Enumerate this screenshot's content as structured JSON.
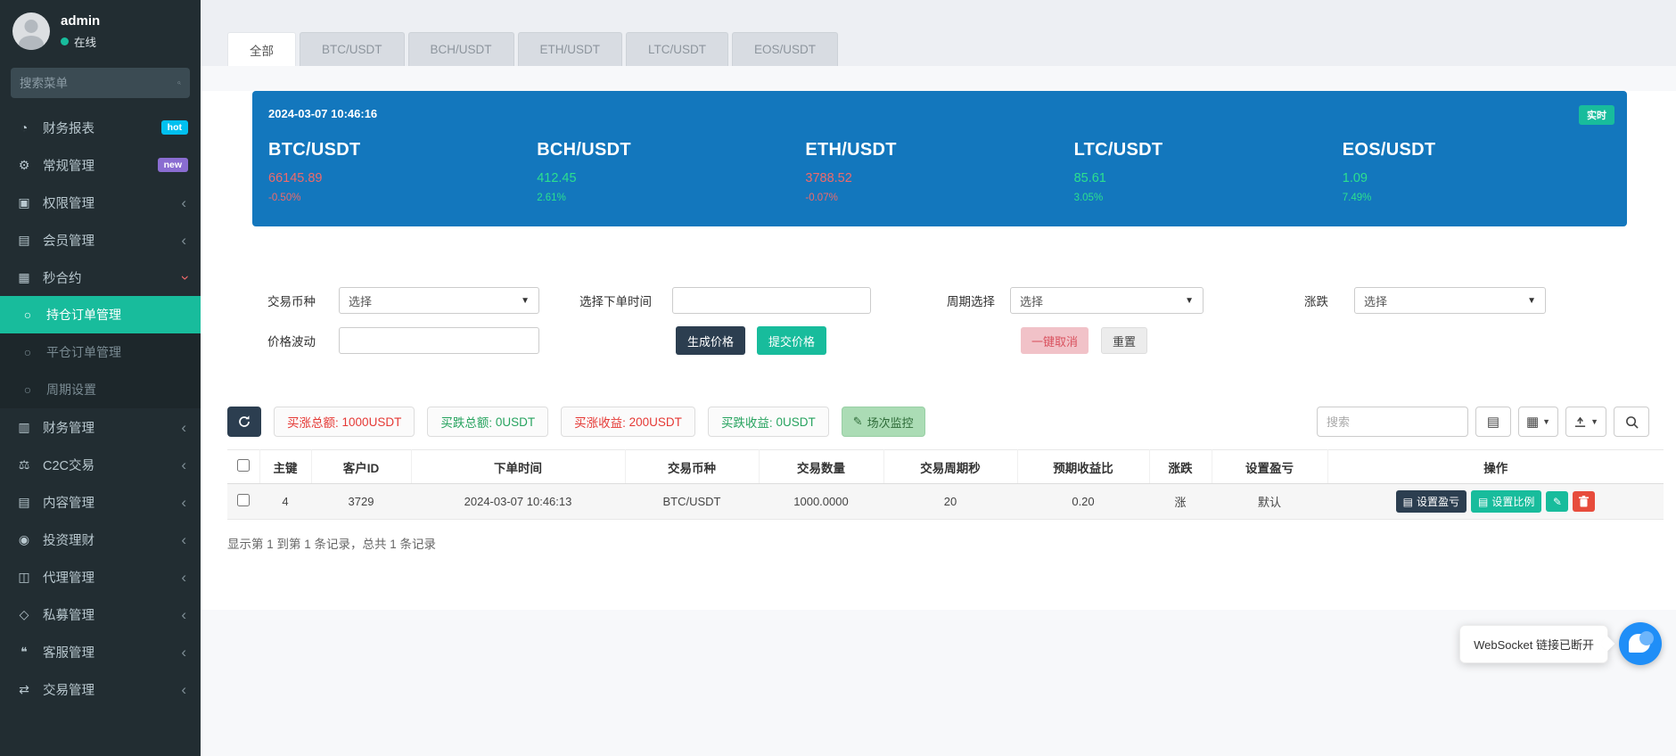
{
  "user": {
    "name": "admin",
    "status": "在线"
  },
  "sidebar": {
    "search_placeholder": "搜索菜单",
    "items": [
      {
        "label": "财务报表",
        "icon": "dashboard-icon",
        "badge": "hot"
      },
      {
        "label": "常规管理",
        "icon": "gears-icon",
        "badge": "new"
      },
      {
        "label": "权限管理",
        "icon": "permissions-icon"
      },
      {
        "label": "会员管理",
        "icon": "members-icon"
      },
      {
        "label": "秒合约",
        "icon": "seconds-contract-icon"
      },
      {
        "label": "持仓订单管理",
        "icon": "circle-icon"
      },
      {
        "label": "平仓订单管理",
        "icon": "circle-icon"
      },
      {
        "label": "周期设置",
        "icon": "circle-icon"
      },
      {
        "label": "财务管理",
        "icon": "finance-icon"
      },
      {
        "label": "C2C交易",
        "icon": "scales-icon"
      },
      {
        "label": "内容管理",
        "icon": "content-icon"
      },
      {
        "label": "投资理财",
        "icon": "investment-icon"
      },
      {
        "label": "代理管理",
        "icon": "briefcase-icon"
      },
      {
        "label": "私募管理",
        "icon": "gem-icon"
      },
      {
        "label": "客服管理",
        "icon": "chat-icon"
      },
      {
        "label": "交易管理",
        "icon": "trade-icon"
      }
    ]
  },
  "tabs": {
    "items": [
      "全部",
      "BTC/USDT",
      "BCH/USDT",
      "ETH/USDT",
      "LTC/USDT",
      "EOS/USDT"
    ],
    "active": "全部"
  },
  "ticker": {
    "timestamp": "2024-03-07 10:46:16",
    "live_badge": "实时",
    "coins": [
      {
        "pair": "BTC/USDT",
        "price": "66145.89",
        "change": "-0.50%",
        "trend": "down"
      },
      {
        "pair": "BCH/USDT",
        "price": "412.45",
        "change": "2.61%",
        "trend": "up"
      },
      {
        "pair": "ETH/USDT",
        "price": "3788.52",
        "change": "-0.07%",
        "trend": "down"
      },
      {
        "pair": "LTC/USDT",
        "price": "85.61",
        "change": "3.05%",
        "trend": "up"
      },
      {
        "pair": "EOS/USDT",
        "price": "1.09",
        "change": "7.49%",
        "trend": "up"
      }
    ]
  },
  "filters": {
    "coin_label": "交易币种",
    "coin_value": "选择",
    "time_label": "选择下单时间",
    "period_label": "周期选择",
    "period_value": "选择",
    "updown_label": "涨跌",
    "updown_value": "选择",
    "price_wave_label": "价格波动",
    "generate_btn": "生成价格",
    "submit_btn": "提交价格",
    "cancel_btn": "一键取消",
    "reset_btn": "重置"
  },
  "stats": {
    "items": [
      {
        "label": "买涨总额:",
        "value": "1000USDT",
        "color": "red"
      },
      {
        "label": "买跌总额:",
        "value": "0USDT",
        "color": "green"
      },
      {
        "label": "买涨收益:",
        "value": "200USDT",
        "color": "red"
      },
      {
        "label": "买跌收益:",
        "value": "0USDT",
        "color": "green"
      }
    ],
    "monitor_btn": "场次监控"
  },
  "toolbar": {
    "search_placeholder": "搜索"
  },
  "table": {
    "headers": [
      "主键",
      "客户ID",
      "下单时间",
      "交易币种",
      "交易数量",
      "交易周期秒",
      "预期收益比",
      "涨跌",
      "设置盈亏",
      "操作"
    ],
    "rows": [
      {
        "id": "4",
        "client_id": "3729",
        "time": "2024-03-07 10:46:13",
        "coin": "BTC/USDT",
        "amount": "1000.0000",
        "period": "20",
        "ratio": "0.20",
        "updown": "涨",
        "profit_set": "默认"
      }
    ],
    "row_actions": {
      "set_profit": "设置盈亏",
      "set_ratio": "设置比例"
    }
  },
  "footer": {
    "summary": "显示第 1 到第 1 条记录，总共 1 条记录"
  },
  "toast": {
    "message": "WebSocket 链接已断开"
  },
  "colors": {
    "accent_green": "#18bc9c",
    "banner_blue": "#1377bd",
    "navy": "#2c3e50",
    "danger_red": "#e74c3c"
  }
}
